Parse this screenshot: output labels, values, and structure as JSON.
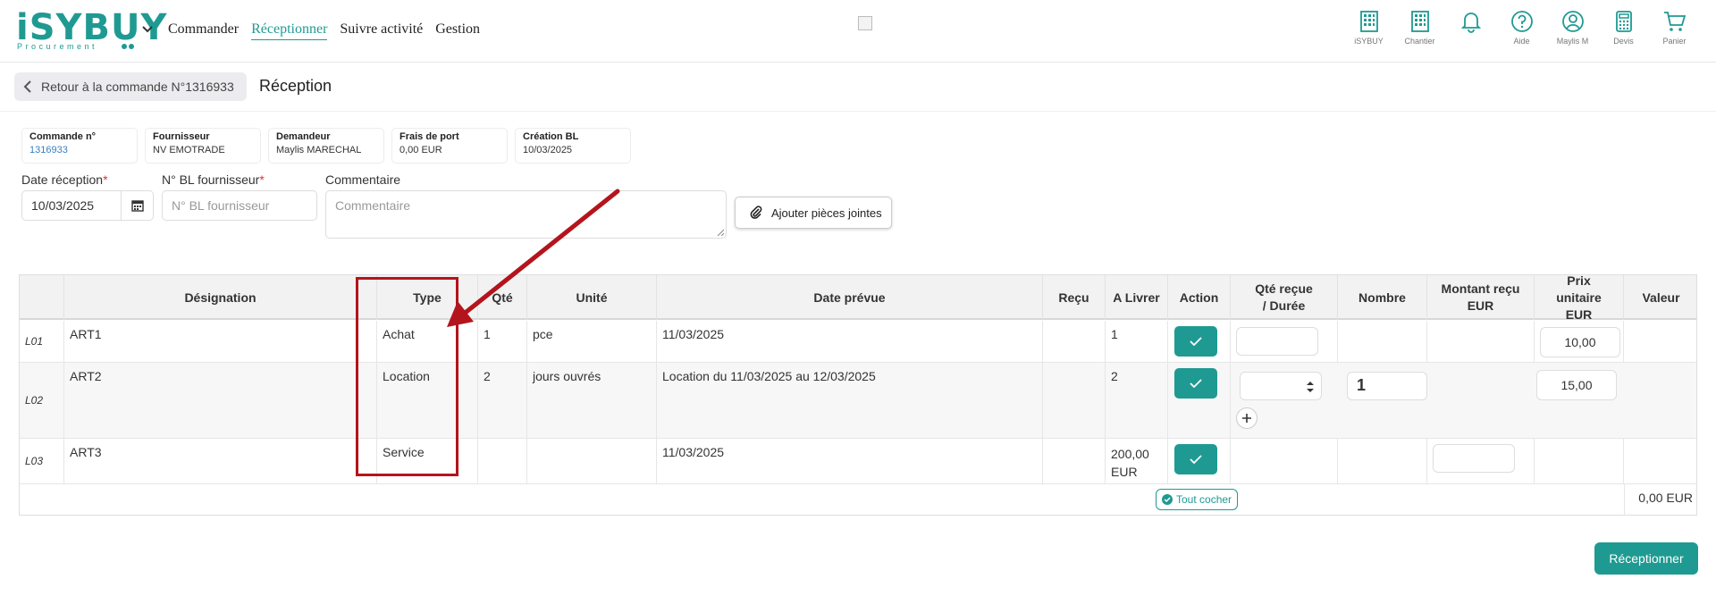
{
  "app": {
    "logo_text": "iSYBUY",
    "logo_sub": "Procurement",
    "nav": [
      "Commander",
      "Réceptionner",
      "Suivre activité",
      "Gestion"
    ],
    "top_icons": [
      {
        "label": "iSYBUY",
        "icon": "building-icon"
      },
      {
        "label": "Chantier",
        "icon": "building-icon"
      },
      {
        "label": "",
        "icon": "bell-icon"
      },
      {
        "label": "Aide",
        "icon": "help-icon"
      },
      {
        "label": "Maylis M",
        "icon": "user-icon"
      },
      {
        "label": "Devis",
        "icon": "calculator-icon"
      },
      {
        "label": "Panier",
        "icon": "cart-icon"
      }
    ],
    "accent_color": "#1f9a92"
  },
  "subheader": {
    "back_label": "Retour à la commande N°1316933",
    "title": "Réception"
  },
  "info": [
    {
      "label": "Commande n°",
      "value": "1316933"
    },
    {
      "label": "Fournisseur",
      "value": "NV EMOTRADE"
    },
    {
      "label": "Demandeur",
      "value": "Maylis MARECHAL"
    },
    {
      "label": "Frais de port",
      "value": "0,00 EUR"
    },
    {
      "label": "Création BL",
      "value": "10/03/2025"
    }
  ],
  "form": {
    "date_label": "Date réception",
    "date_value": "10/03/2025",
    "bl_label": "N° BL fournisseur",
    "bl_placeholder": "N° BL fournisseur",
    "comment_label": "Commentaire",
    "comment_placeholder": "Commentaire",
    "attach_label": "Ajouter pièces jointes"
  },
  "table": {
    "headers": {
      "designation": "Désignation",
      "type": "Type",
      "qte": "Qté",
      "unite": "Unité",
      "date": "Date prévue",
      "recu": "Reçu",
      "alivrer": "A Livrer",
      "action": "Action",
      "qte_recue": "Qté reçue / Durée",
      "nombre": "Nombre",
      "montant": "Montant reçu EUR",
      "prix": "Prix unitaire EUR",
      "valeur": "Valeur"
    },
    "rows": [
      {
        "line": "L01",
        "designation": "ART1",
        "type": "Achat",
        "qte": "1",
        "unite": "pce",
        "date": "11/03/2025",
        "alivrer": "1",
        "nombre": "",
        "prix": "10,00"
      },
      {
        "line": "L02",
        "designation": "ART2",
        "type": "Location",
        "qte": "2",
        "unite": "jours ouvrés",
        "date": "Location du 11/03/2025 au 12/03/2025",
        "alivrer": "2",
        "nombre": "1",
        "prix": "15,00"
      },
      {
        "line": "L03",
        "designation": "ART3",
        "type": "Service",
        "qte": "",
        "unite": "",
        "date": "11/03/2025",
        "alivrer": "200,00 EUR",
        "nombre": "",
        "prix": ""
      }
    ],
    "tout_cocher": "Tout cocher",
    "total": "0,00 EUR"
  },
  "footer": {
    "receive_label": "Réceptionner"
  }
}
